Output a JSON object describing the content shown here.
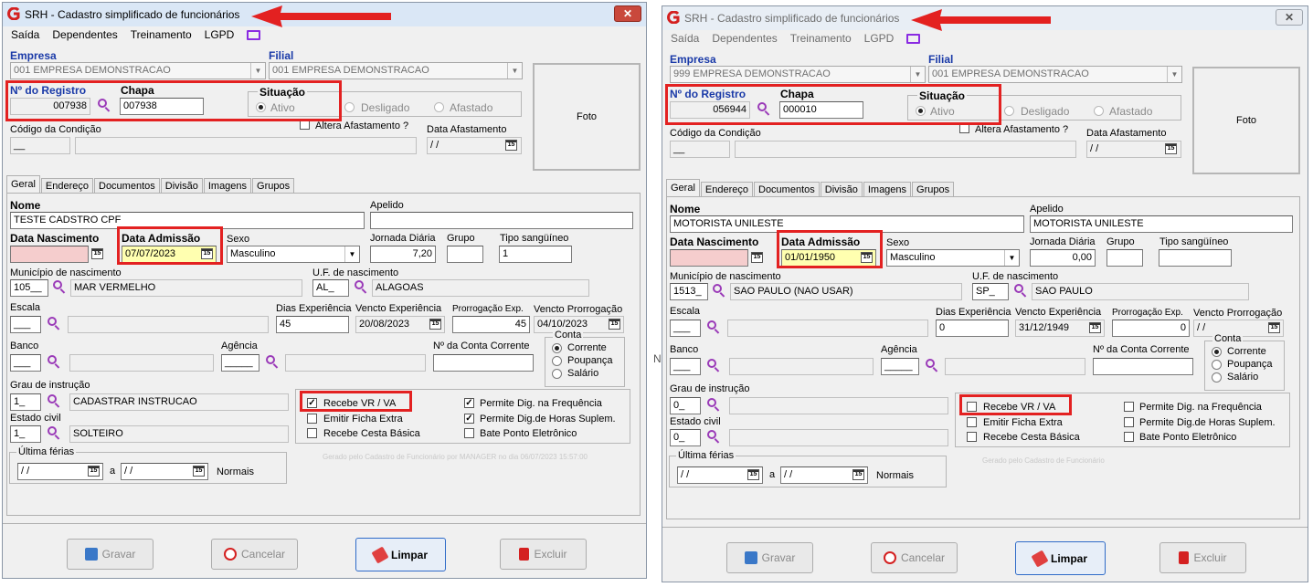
{
  "brand_color": "#d42020",
  "annotation_color": "#e32121",
  "separator_glyph": "N",
  "windows": [
    {
      "title": "SRH - Cadastro simplificado de funcionários",
      "close": "✕",
      "menu": [
        "Saída",
        "Dependentes",
        "Treinamento",
        "LGPD"
      ],
      "empresa_label": "Empresa",
      "empresa_value": "001 EMPRESA DEMONSTRACAO",
      "filial_label": "Filial",
      "filial_value": "001 EMPRESA DEMONSTRACAO",
      "foto_label": "Foto",
      "registro_label": "Nº do Registro",
      "registro_value": "007938",
      "chapa_label": "Chapa",
      "chapa_value": "007938",
      "situacao_label": "Situação",
      "sit_ativo": "Ativo",
      "sit_desligado": "Desligado",
      "sit_afastado": "Afastado",
      "altera_label": "Altera Afastamento ?",
      "codcond_label": "Código da Condição",
      "codcond_value": "__",
      "dataafast_label": "Data Afastamento",
      "dataafast_value": "/ /",
      "tabs": [
        "Geral",
        "Endereço",
        "Documentos",
        "Divisão",
        "Imagens",
        "Grupos"
      ],
      "nome_label": "Nome",
      "nome_value": "TESTE CADSTRO CPF",
      "apelido_label": "Apelido",
      "apelido_value": "",
      "datanasc_label": "Data Nascimento",
      "datanasc_value": "",
      "dataadm_label": "Data Admissão",
      "dataadm_value": "07/07/2023",
      "sexo_label": "Sexo",
      "sexo_value": "Masculino",
      "jornada_label": "Jornada Diária",
      "jornada_value": "7,20",
      "grupo_label": "Grupo",
      "grupo_value": "",
      "tiposang_label": "Tipo sangüíneo",
      "tiposang_value": "1",
      "municipio_label": "Município de nascimento",
      "municipio_code": "105__",
      "municipio_name": "MAR VERMELHO",
      "uf_label": "U.F. de nascimento",
      "uf_code": "AL_",
      "uf_name": "ALAGOAS",
      "escala_label": "Escala",
      "escala_value": "___",
      "diasexp_label": "Dias Experiência",
      "diasexp_value": "45",
      "venctoexp_label": "Vencto Experiência",
      "venctoexp_value": "20/08/2023",
      "prorrog_label": "Prorrogação Exp.",
      "prorrog_value": "45",
      "venctoprorrog_label": "Vencto Prorrogação",
      "venctoprorrog_value": "04/10/2023",
      "banco_label": "Banco",
      "banco_value": "___",
      "agencia_label": "Agência",
      "agencia_value": "_____",
      "conta_label": "Nº da Conta Corrente",
      "conta_value": "",
      "conta_group": "Conta",
      "conta_corrente": "Corrente",
      "conta_poupanca": "Poupança",
      "conta_salario": "Salário",
      "grau_label": "Grau de instrução",
      "grau_code": "1_",
      "grau_name": "CADASTRAR INSTRUCAO",
      "estcivil_label": "Estado civil",
      "estcivil_code": "1_",
      "estcivil_name": "SOLTEIRO",
      "recebe_vr": "Recebe VR / VA",
      "emitir_ficha": "Emitir Ficha Extra",
      "cesta": "Recebe Cesta Básica",
      "permite_freq": "Permite Dig. na Frequência",
      "permite_horas": "Permite Dig.de Horas Suplem.",
      "bate_ponto": "Bate Ponto Eletrônico",
      "check_vr": true,
      "check_emitir": false,
      "check_cesta": false,
      "check_freq": true,
      "check_horas": true,
      "check_ponto": false,
      "ferias_label": "Última férias",
      "ferias_de": "/ /",
      "ferias_a": "a",
      "ferias_ate": "/ /",
      "ferias_normais": "Normais",
      "watermark": "Gerado pelo Cadastro de Funcionário por MANAGER no dia 06/07/2023 15:57:00",
      "buttons": [
        "Gravar",
        "Cancelar",
        "Limpar",
        "Excluir"
      ]
    },
    {
      "title": "SRH - Cadastro simplificado de funcionários",
      "close": "✕",
      "menu": [
        "Saída",
        "Dependentes",
        "Treinamento",
        "LGPD"
      ],
      "empresa_label": "Empresa",
      "empresa_value": "999 EMPRESA DEMONSTRACAO",
      "filial_label": "Filial",
      "filial_value": "001 EMPRESA DEMONSTRACAO",
      "foto_label": "Foto",
      "registro_label": "Nº do Registro",
      "registro_value": "056944",
      "chapa_label": "Chapa",
      "chapa_value": "000010",
      "situacao_label": "Situação",
      "sit_ativo": "Ativo",
      "sit_desligado": "Desligado",
      "sit_afastado": "Afastado",
      "altera_label": "Altera Afastamento ?",
      "codcond_label": "Código da Condição",
      "codcond_value": "__",
      "dataafast_label": "Data Afastamento",
      "dataafast_value": "/ /",
      "tabs": [
        "Geral",
        "Endereço",
        "Documentos",
        "Divisão",
        "Imagens",
        "Grupos"
      ],
      "nome_label": "Nome",
      "nome_value": "MOTORISTA UNILESTE",
      "apelido_label": "Apelido",
      "apelido_value": "MOTORISTA UNILESTE",
      "datanasc_label": "Data Nascimento",
      "datanasc_value": "",
      "dataadm_label": "Data Admissão",
      "dataadm_value": "01/01/1950",
      "sexo_label": "Sexo",
      "sexo_value": "Masculino",
      "jornada_label": "Jornada Diária",
      "jornada_value": "0,00",
      "grupo_label": "Grupo",
      "grupo_value": "",
      "tiposang_label": "Tipo sangüíneo",
      "tiposang_value": "",
      "municipio_label": "Município de nascimento",
      "municipio_code": "1513_",
      "municipio_name": "SAO PAULO (NAO USAR)",
      "uf_label": "U.F. de nascimento",
      "uf_code": "SP_",
      "uf_name": "SAO PAULO",
      "escala_label": "Escala",
      "escala_value": "___",
      "diasexp_label": "Dias Experiência",
      "diasexp_value": "0",
      "venctoexp_label": "Vencto Experiência",
      "venctoexp_value": "31/12/1949",
      "prorrog_label": "Prorrogação Exp.",
      "prorrog_value": "0",
      "venctoprorrog_label": "Vencto Prorrogação",
      "venctoprorrog_value": "/ /",
      "banco_label": "Banco",
      "banco_value": "___",
      "agencia_label": "Agência",
      "agencia_value": "_____",
      "conta_label": "Nº da Conta Corrente",
      "conta_value": "",
      "conta_group": "Conta",
      "conta_corrente": "Corrente",
      "conta_poupanca": "Poupança",
      "conta_salario": "Salário",
      "grau_label": "Grau de instrução",
      "grau_code": "0_",
      "grau_name": "",
      "estcivil_label": "Estado civil",
      "estcivil_code": "0_",
      "estcivil_name": "",
      "recebe_vr": "Recebe VR / VA",
      "emitir_ficha": "Emitir Ficha Extra",
      "cesta": "Recebe Cesta Básica",
      "permite_freq": "Permite Dig. na Frequência",
      "permite_horas": "Permite Dig.de Horas Suplem.",
      "bate_ponto": "Bate Ponto Eletrônico",
      "check_vr": false,
      "check_emitir": false,
      "check_cesta": false,
      "check_freq": false,
      "check_horas": false,
      "check_ponto": false,
      "ferias_label": "Última férias",
      "ferias_de": "/ /",
      "ferias_a": "a",
      "ferias_ate": "/ /",
      "ferias_normais": "Normais",
      "watermark": "Gerado pelo Cadastro de Funcionário",
      "buttons": [
        "Gravar",
        "Cancelar",
        "Limpar",
        "Excluir"
      ]
    }
  ]
}
